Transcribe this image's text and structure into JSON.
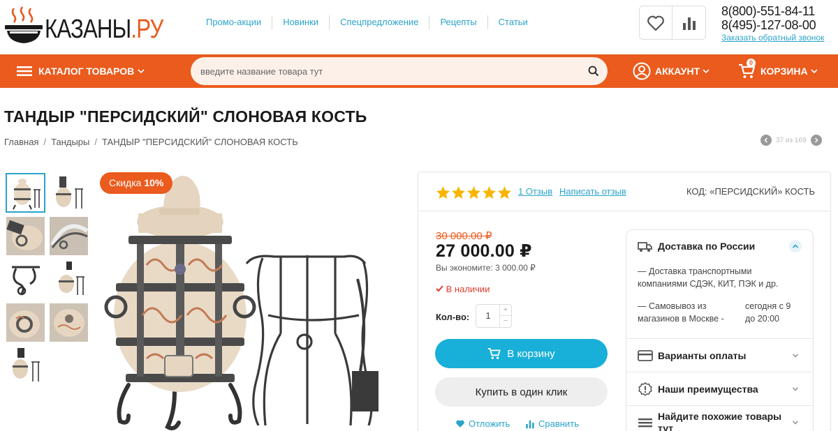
{
  "header": {
    "logo_text": "КАЗАНЫ",
    "logo_suffix": ".РУ",
    "nav": [
      "Промо-акции",
      "Новинки",
      "Спецпредложение",
      "Рецепты",
      "Статьи"
    ],
    "phones": [
      "8(800)-551-84-11",
      "8(495)-127-08-00"
    ],
    "callback": "Заказать обратный звонок"
  },
  "toolbar": {
    "catalog_label": "КАТАЛОГ ТОВАРОВ",
    "search_placeholder": "введите название товара тут",
    "account_label": "АККАУНТ",
    "cart_label": "КОРЗИНА",
    "cart_count": "0"
  },
  "product": {
    "title": "ТАНДЫР \"ПЕРСИДСКИЙ\" СЛОНОВАЯ КОСТЬ",
    "breadcrumbs": [
      "Главная",
      "Тандыры",
      "ТАНДЫР \"ПЕРСИДСКИЙ\" СЛОНОВАЯ КОСТЬ"
    ],
    "pager_text": "37 из 169",
    "discount_prefix": "Скидка",
    "discount_value": "10%",
    "rating": 5,
    "reviews_link": "1 Отзыв",
    "write_review": "Написать отзыв",
    "sku": "КОД:  «ПЕРСИДСКИЙ» КОСТЬ",
    "old_price": "30 000.00 ₽",
    "price": "27 000.00 ₽",
    "savings": "Вы экономите: 3 000.00 ₽",
    "stock": "В наличии",
    "qty_label": "Кол-во:",
    "qty_value": "1",
    "add_to_cart": "В корзину",
    "buy_one_click": "Купить в один клик",
    "defer": "Отложить",
    "compare": "Сравнить"
  },
  "info": {
    "delivery_title": "Доставка по России",
    "delivery_line1": "— Доставка транспортными компаниями СДЭК, КИТ, ПЭК и др.",
    "pickup_left": "— Самовывоз из магазинов в Москве -",
    "pickup_right": "сегодня с 9 до 20:00",
    "payment_title": "Варианты оплаты",
    "advantages_title": "Наши преимущества",
    "similar_title": "Найдите похожие товары тут"
  },
  "colors": {
    "brand_orange": "#ea5b1d",
    "accent_blue": "#18afd8",
    "link_blue": "#2aa4c9",
    "star_yellow": "#f7b500"
  }
}
